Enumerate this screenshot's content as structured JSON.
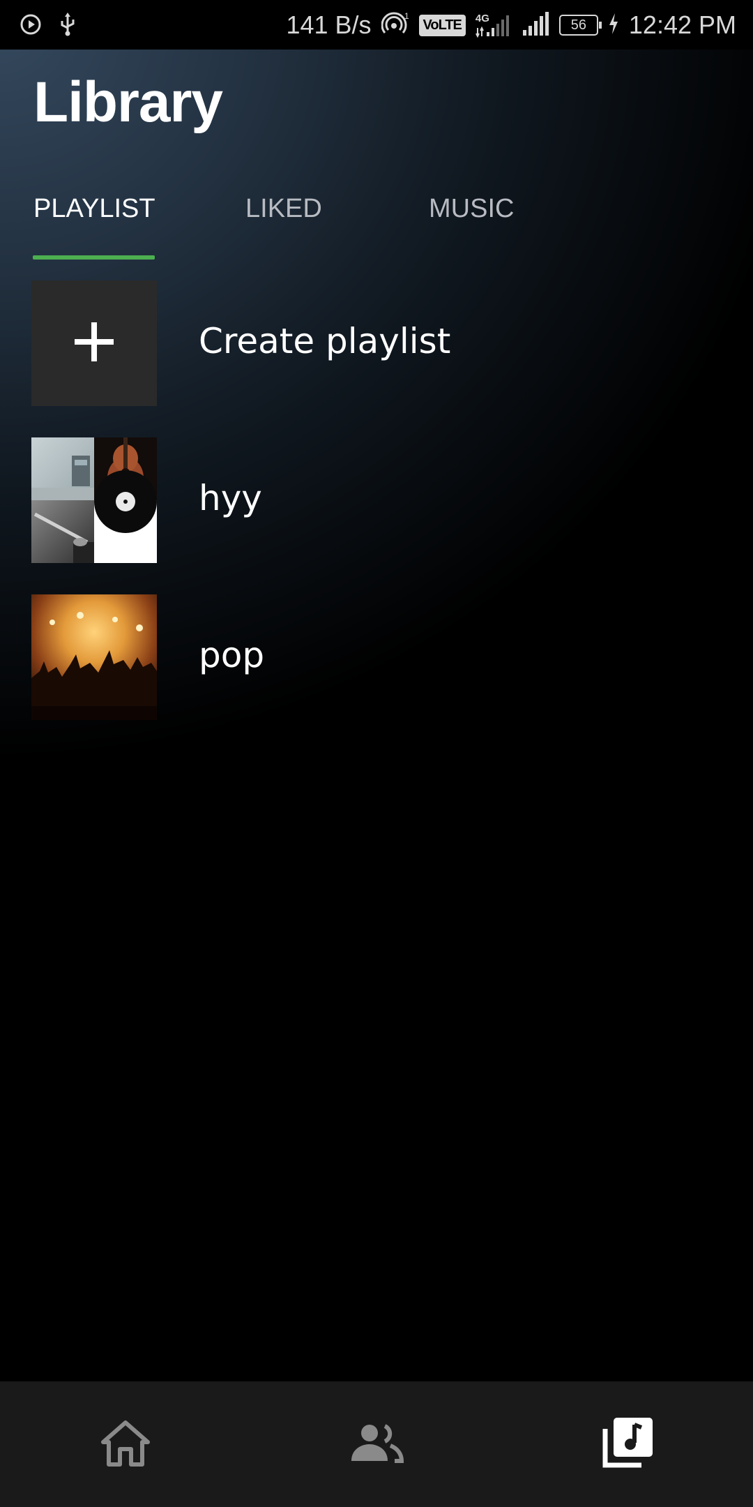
{
  "status_bar": {
    "net_speed": "141 B/s",
    "volte": "VoLTE",
    "network_type": "4G",
    "battery_level": "56",
    "time": "12:42 PM"
  },
  "header": {
    "title": "Library"
  },
  "tabs": [
    {
      "label": "PLAYLIST",
      "active": true
    },
    {
      "label": "LIKED",
      "active": false
    },
    {
      "label": "MUSIC",
      "active": false
    }
  ],
  "list": {
    "create_label": "Create playlist",
    "items": [
      {
        "label": "hyy",
        "thumb": "collage-instruments-icon"
      },
      {
        "label": "pop",
        "thumb": "concert-crowd-image"
      }
    ]
  },
  "bottom_nav": [
    {
      "icon": "home-icon",
      "active": false
    },
    {
      "icon": "people-icon",
      "active": false
    },
    {
      "icon": "library-music-icon",
      "active": true
    }
  ],
  "colors": {
    "accent": "#4caf50",
    "nav_active": "#ffffff",
    "nav_inactive": "#8a8a8a"
  }
}
